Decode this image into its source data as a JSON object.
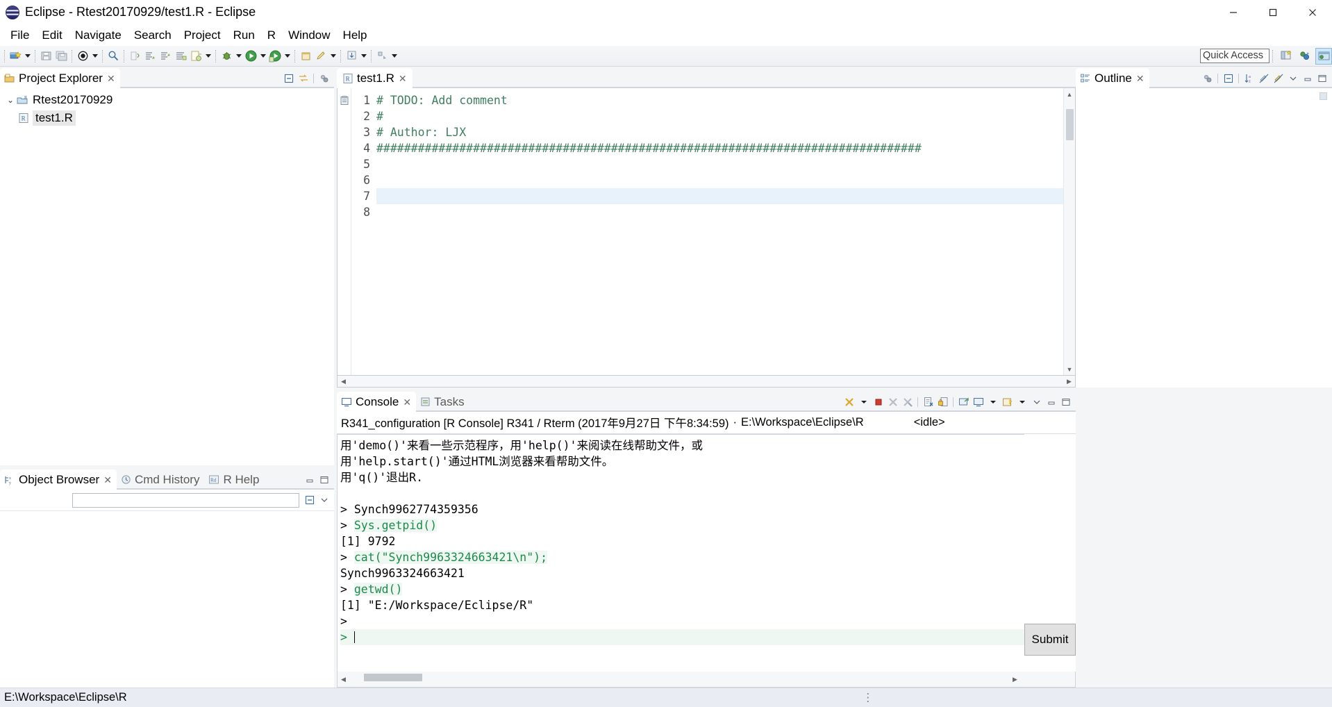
{
  "window": {
    "title": "Eclipse - Rtest20170929/test1.R - Eclipse",
    "logo_icon": "eclipse-logo-icon",
    "minimize_label": "—",
    "maximize_label": "❐",
    "close_label": "✕"
  },
  "menubar": {
    "items": [
      {
        "label": "File"
      },
      {
        "label": "Edit"
      },
      {
        "label": "Navigate"
      },
      {
        "label": "Search"
      },
      {
        "label": "Project"
      },
      {
        "label": "Run"
      },
      {
        "label": "R"
      },
      {
        "label": "Window"
      },
      {
        "label": "Help"
      }
    ]
  },
  "toolbar": {
    "quick_access_placeholder": "Quick Access",
    "quick_access_value": "Quick Access",
    "groups": [
      {
        "icons": [
          "new-wizard-icon"
        ],
        "arrow": true
      },
      {
        "icons": [
          "save-icon",
          "save-all-icon"
        ],
        "arrow": false
      },
      {
        "icons": [
          "print-icon"
        ],
        "arrow": true
      },
      {
        "icons": [
          "search-icon"
        ],
        "arrow": false
      },
      {
        "icons": [
          "next-annotation-icon",
          "previous-edit-icon",
          "last-edit-icon",
          "back-icon",
          "forward-icon"
        ],
        "arrow": true
      },
      {
        "icons": [
          "debug-icon"
        ],
        "arrow": true
      },
      {
        "icons": [
          "run-icon"
        ],
        "arrow": true
      },
      {
        "icons": [
          "run-r-icon"
        ],
        "arrow": true
      },
      {
        "icons": [
          "new-r-console-icon",
          "edit-icon"
        ],
        "arrow": true
      },
      {
        "icons": [
          "download-icon"
        ],
        "arrow": true
      },
      {
        "icons": [
          "external-tools-icon"
        ],
        "arrow": true
      }
    ],
    "perspective_icons": [
      "open-perspective-icon",
      "perspective-r-icon",
      "perspective-r-active-icon"
    ]
  },
  "project_explorer": {
    "tab_label": "Project Explorer",
    "tab_icon": "project-explorer-icon",
    "tab_close": "✕",
    "tools": [
      "collapse-all-icon",
      "link-with-editor-icon",
      "view-menu-icon"
    ],
    "tree": [
      {
        "label": "Rtest20170929",
        "icon": "r-project-folder-icon",
        "expanded": true,
        "twisty": "⌄",
        "level": 0,
        "selected": false
      },
      {
        "label": "test1.R",
        "icon": "r-file-icon",
        "expanded": false,
        "twisty": "",
        "level": 1,
        "selected": true
      }
    ]
  },
  "object_browser": {
    "tabs": [
      {
        "label": "Object Browser",
        "icon": "object-browser-icon",
        "active": true,
        "close": "✕"
      },
      {
        "label": "Cmd History",
        "icon": "cmd-history-icon",
        "active": false
      },
      {
        "label": "R Help",
        "icon": "r-help-icon",
        "active": false
      }
    ],
    "tools": [
      "minimize-icon",
      "maximize-icon"
    ],
    "filter_placeholder": "",
    "filter_value": "",
    "filter_icons": [
      "pencil-icon",
      "collapse-all-icon",
      "view-menu-icon"
    ]
  },
  "editor": {
    "tab_label": "test1.R",
    "tab_icon": "r-file-icon",
    "tab_close": "✕",
    "view_tools": [
      "restore-icon",
      "minimize-icon",
      "maximize-icon"
    ],
    "lines": [
      {
        "n": "1",
        "text": "# TODO: Add comment",
        "marker": "todo-task-icon",
        "current": false
      },
      {
        "n": "2",
        "text": "#",
        "marker": "",
        "current": false
      },
      {
        "n": "3",
        "text": "# Author: LJX",
        "marker": "",
        "current": false
      },
      {
        "n": "4",
        "text": "###############################################################################",
        "marker": "",
        "current": false
      },
      {
        "n": "5",
        "text": "",
        "marker": "",
        "current": false
      },
      {
        "n": "6",
        "text": "",
        "marker": "",
        "current": false
      },
      {
        "n": "7",
        "text": "",
        "marker": "",
        "current": true
      },
      {
        "n": "8",
        "text": "",
        "marker": "",
        "current": false
      }
    ]
  },
  "outline": {
    "tab_label": "Outline",
    "tab_icon": "outline-icon",
    "tab_close": "✕",
    "tools": [
      "focus-on-active-task-icon",
      "collapse-all-icon",
      "sort-icon",
      "hide-non-public-icon",
      "hide-local-icon",
      "view-menu-icon",
      "minimize-icon",
      "maximize-icon"
    ],
    "content": ""
  },
  "console": {
    "tabs": [
      {
        "label": "Console",
        "icon": "console-icon",
        "active": true,
        "close": "✕"
      },
      {
        "label": "Tasks",
        "icon": "tasks-icon",
        "active": false
      }
    ],
    "tools": [
      "terminate-remove-icon",
      "terminate-remove-menu-icon",
      "terminate-icon",
      "remove-launch-icon",
      "remove-all-terminated-icon",
      "clear-console-icon",
      "lock-scroll-icon",
      "show-console-on-output-icon",
      "display-selected-console-icon",
      "display-selected-console-menu-icon",
      "open-console-icon",
      "open-console-menu-icon",
      "view-menu-icon",
      "minimize-icon",
      "maximize-icon"
    ],
    "header": {
      "config_name": "R341_configuration [R Console] R341 / Rterm (2017年9月27日 下午8:34:59)",
      "separator": "·",
      "workspace_path": "E:\\Workspace\\Eclipse\\R",
      "state": "<idle>"
    },
    "output": [
      {
        "text": "用'demo()'来看一些示范程序，用'help()'来阅读在线帮助文件，或",
        "kind": "out"
      },
      {
        "text": "用'help.start()'通过HTML浏览器来看帮助文件。",
        "kind": "out"
      },
      {
        "text": "用'q()'退出R.",
        "kind": "out"
      },
      {
        "text": "",
        "kind": "out"
      },
      {
        "text": "> Synch9962774359356",
        "kind": "out"
      },
      {
        "text": "Sys.getpid()",
        "kind": "in"
      },
      {
        "text": "[1] 9792",
        "kind": "out"
      },
      {
        "text": "cat(\"Synch9963324663421\\n\");",
        "kind": "in"
      },
      {
        "text": "Synch9963324663421",
        "kind": "out"
      },
      {
        "text": "getwd()",
        "kind": "in"
      },
      {
        "text": "[1] \"E:/Workspace/Eclipse/R\"",
        "kind": "out"
      },
      {
        "text": ">",
        "kind": "out"
      },
      {
        "text": "",
        "kind": "caret"
      }
    ],
    "prompt_symbol": ">",
    "submit_label": "Submit"
  },
  "statusbar": {
    "path": "E:\\Workspace\\Eclipse\\R"
  },
  "colors": {
    "comment_green": "#3f7f5f",
    "console_input_green": "#1e8a4c",
    "current_line": "#e8f2fb",
    "tab_active_bg": "#ffffff",
    "titlebar_bg": "#ffffff",
    "statusbar_bg": "#e9edf3"
  }
}
